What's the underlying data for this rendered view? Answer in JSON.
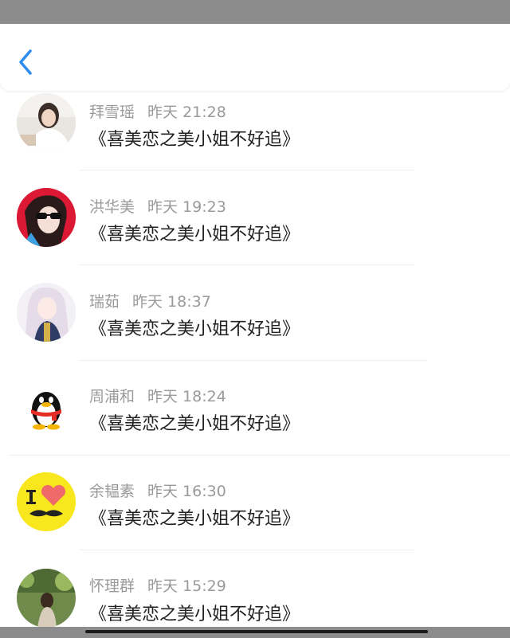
{
  "nav": {
    "back_icon": "chevron-left-icon",
    "accent": "#2d8cf0"
  },
  "messages": [
    {
      "name": "拜雪瑶",
      "time": "昨天 21:28",
      "text": "《喜美恋之美小姐不好追》"
    },
    {
      "name": "洪华美",
      "time": "昨天 19:23",
      "text": "《喜美恋之美小姐不好追》"
    },
    {
      "name": "瑞茹",
      "time": "昨天 18:37",
      "text": "《喜美恋之美小姐不好追》"
    },
    {
      "name": "周浦和",
      "time": "昨天 18:24",
      "text": "《喜美恋之美小姐不好追》"
    },
    {
      "name": "余韫素",
      "time": "昨天 16:30",
      "text": "《喜美恋之美小姐不好追》"
    },
    {
      "name": "怀理群",
      "time": "昨天 15:29",
      "text": "《喜美恋之美小姐不好追》"
    }
  ]
}
